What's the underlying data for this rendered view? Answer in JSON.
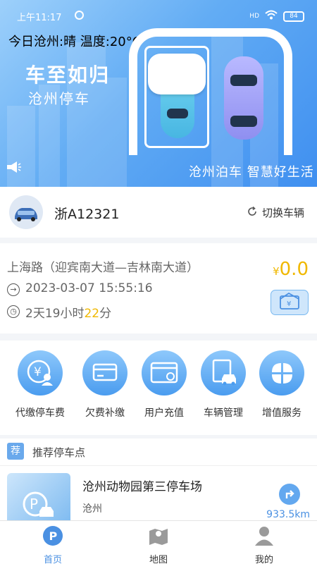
{
  "status_bar": {
    "time": "上午11:17",
    "battery": "84",
    "signal": "HD"
  },
  "banner": {
    "weather": "今日沧州:晴 温度:20°C",
    "slogan_main": "车至如归",
    "slogan_sub": "沧州停车",
    "marquee": "沧州泊车 智慧好生活"
  },
  "vehicle": {
    "plate": "浙A12321",
    "switch_label": "切换车辆"
  },
  "record": {
    "road": "上海路（迎宾南大道—吉林南大道）",
    "entry_time": "2023-03-07 15:55:16",
    "duration_prefix": "2天19小时",
    "duration_minutes": "22",
    "duration_suffix": "分",
    "fee_symbol": "¥",
    "fee": "0.0"
  },
  "services": [
    {
      "label": "代缴停车费",
      "icon": "yen-person-icon"
    },
    {
      "label": "欠费补缴",
      "icon": "card-icon"
    },
    {
      "label": "用户充值",
      "icon": "wallet-icon"
    },
    {
      "label": "车辆管理",
      "icon": "car-clipboard-icon"
    },
    {
      "label": "增值服务",
      "icon": "clover-icon"
    }
  ],
  "recommend": {
    "tag": "荐",
    "title": "推荐停车点",
    "lot_name": "沧州动物园第三停车场",
    "lot_city": "沧州",
    "distance": "933.5km"
  },
  "tabs": [
    {
      "label": "首页",
      "icon": "home-p-icon",
      "active": true
    },
    {
      "label": "地图",
      "icon": "map-icon",
      "active": false
    },
    {
      "label": "我的",
      "icon": "person-icon",
      "active": false
    }
  ],
  "colors": {
    "accent": "#4a90e2",
    "highlight": "#f0b800",
    "banner": "#62acf4"
  }
}
